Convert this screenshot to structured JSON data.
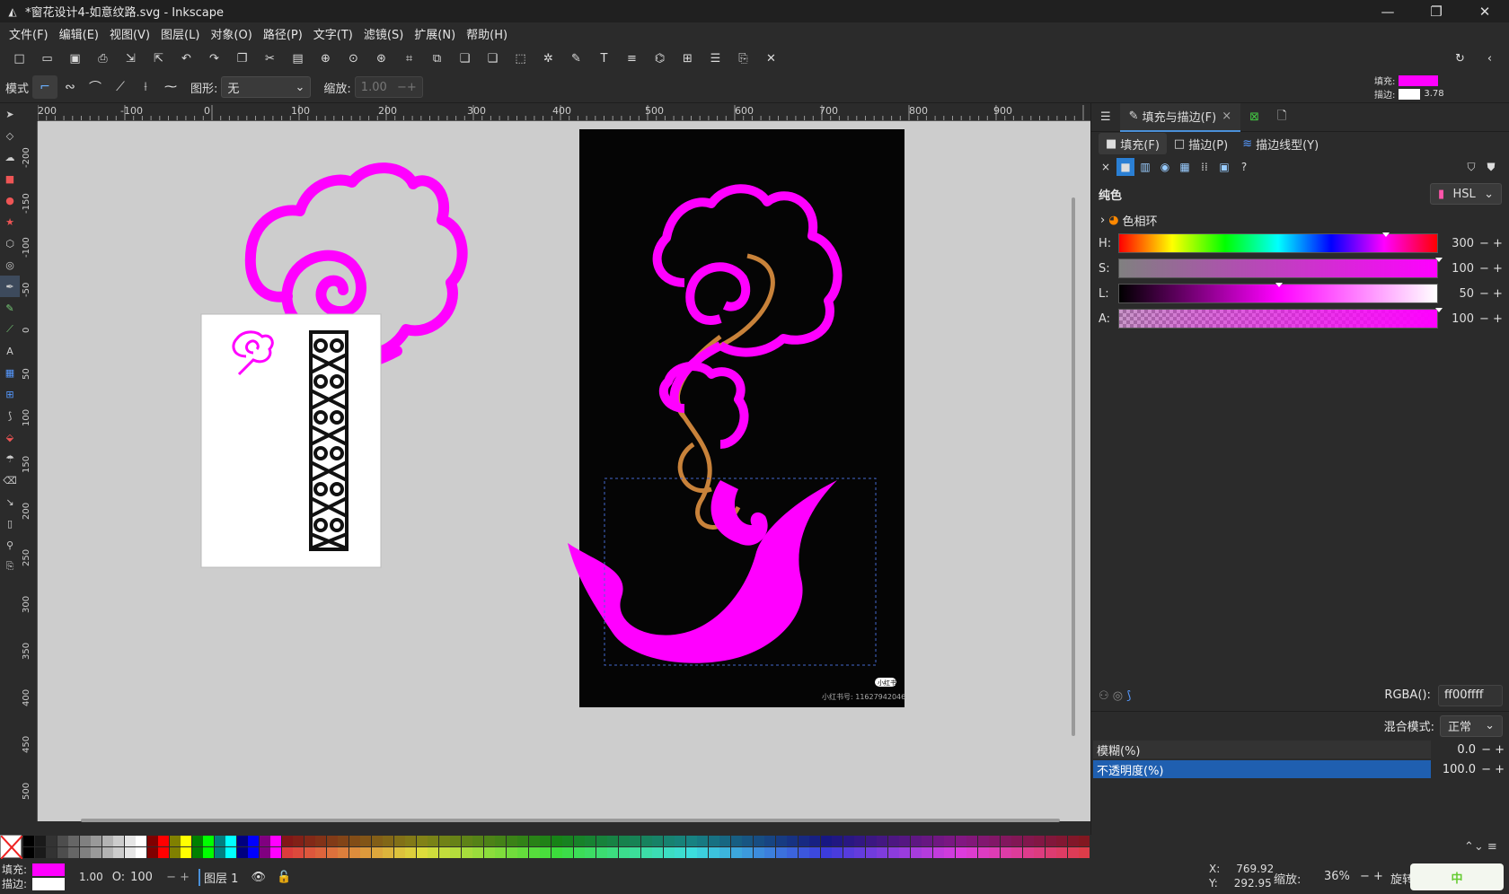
{
  "window": {
    "title": "*窗花设计4-如意纹路.svg - Inkscape",
    "controls": [
      "—",
      "❐",
      "✕"
    ]
  },
  "menu": [
    "文件(F)",
    "编辑(E)",
    "视图(V)",
    "图层(L)",
    "对象(O)",
    "路径(P)",
    "文字(T)",
    "滤镜(S)",
    "扩展(N)",
    "帮助(H)"
  ],
  "toolctl": {
    "mode_label": "模式",
    "shape_label": "图形:",
    "shape_value": "无",
    "scale_label": "缩放:",
    "scale_value": "1.00"
  },
  "fill_indicator": {
    "fill_label": "填充:",
    "stroke_label": "描边:",
    "stroke_width": "3.78",
    "fill_color": "#ff00ff",
    "stroke_color": "#ffffff"
  },
  "ruler_h": [
    "200",
    "-100",
    "0",
    "100",
    "200",
    "300",
    "400",
    "500",
    "600",
    "700",
    "800",
    "900"
  ],
  "ruler_v": [
    "-200",
    "-150",
    "-100",
    "-50",
    "0",
    "50",
    "100",
    "150",
    "200",
    "250",
    "300",
    "350",
    "400",
    "450",
    "500"
  ],
  "canvas": {
    "dark_page_watermark": "小红书号: 11627942046",
    "dark_page_badge": "小红书"
  },
  "dock": {
    "tab_active": "填充与描边(F)",
    "subtab_fill": "填充(F)",
    "subtab_stroke": "描边(P)",
    "subtab_style": "描边线型(Y)",
    "flat_color": "纯色",
    "color_mode": "HSL",
    "wheel_label": "色相环",
    "sliders": [
      {
        "name": "H:",
        "value": "300",
        "level": 0.833
      },
      {
        "name": "S:",
        "value": "100",
        "level": 1.0
      },
      {
        "name": "L:",
        "value": "50",
        "level": 0.5
      },
      {
        "name": "A:",
        "value": "100",
        "level": 1.0
      }
    ],
    "rgba_label": "RGBA():",
    "rgba_value": "ff00ffff",
    "blend_label": "混合模式:",
    "blend_value": "正常",
    "blur_label": "模糊(%)",
    "blur_value": "0.0",
    "opacity_label": "不透明度(%)",
    "opacity_value": "100.0"
  },
  "status": {
    "fill_label": "填充:",
    "stroke_label": "描边:",
    "stroke_width": "1.00",
    "o_label": "O:",
    "o_value": "100",
    "layer": "图层 1",
    "x_label": "X:",
    "x_value": "769.92",
    "y_label": "Y:",
    "y_value": "292.95",
    "zoom_label": "缩放:",
    "zoom_value": "36%",
    "rotate_label": "旋转",
    "ime_text": "中"
  },
  "colors": {
    "magenta": "#ff00ff",
    "accent": "#4a90d9"
  }
}
